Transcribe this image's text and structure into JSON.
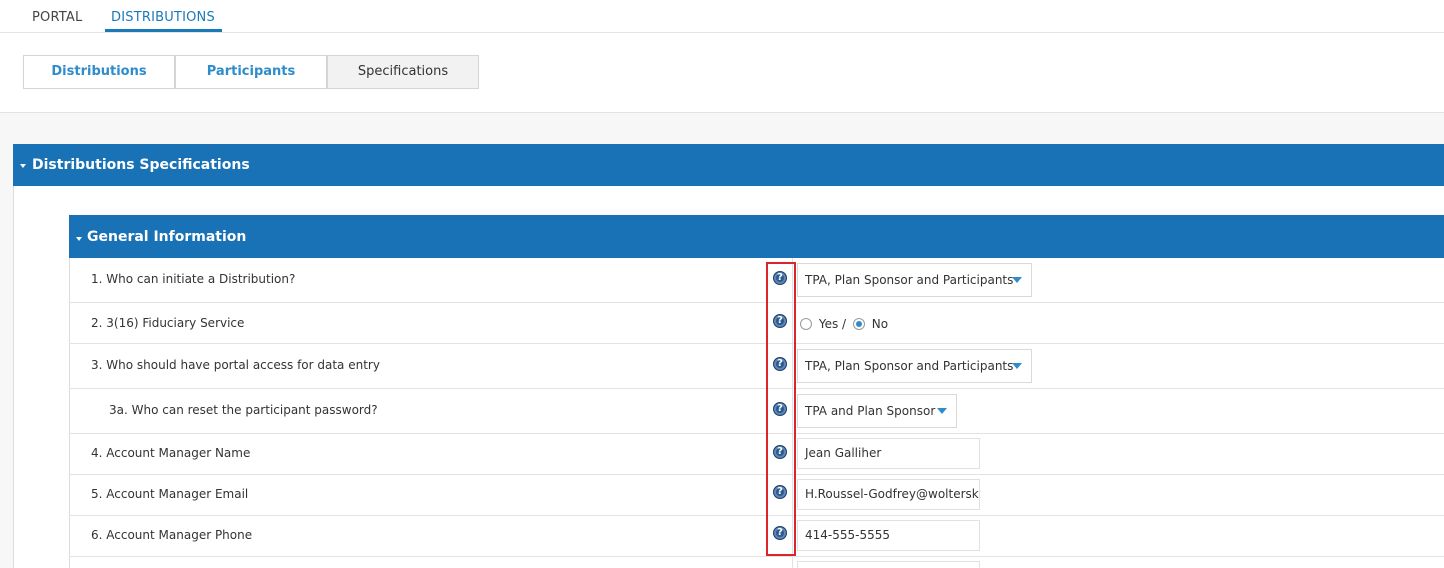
{
  "topnav": {
    "portal": "PORTAL",
    "distributions": "DISTRIBUTIONS"
  },
  "subtabs": {
    "distributions": "Distributions",
    "participants": "Participants",
    "specifications": "Specifications"
  },
  "panel": {
    "title": "Distributions Specifications"
  },
  "section": {
    "title": "General Information"
  },
  "rows": [
    {
      "label": "1. Who can initiate a Distribution?",
      "type": "select",
      "value": "TPA, Plan Sponsor and Participants"
    },
    {
      "label": "2. 3(16) Fiduciary Service",
      "type": "radio",
      "yes": "Yes /",
      "no": "No",
      "selected": "No"
    },
    {
      "label": "3. Who should have portal access for data entry",
      "type": "select",
      "value": "TPA, Plan Sponsor and Participants"
    },
    {
      "label": "3a. Who can reset the participant password?",
      "type": "select",
      "value": "TPA and Plan Sponsor"
    },
    {
      "label": "4. Account Manager Name",
      "type": "text",
      "value": "Jean Galliher"
    },
    {
      "label": "5. Account Manager Email",
      "type": "text",
      "value": "H.Roussel-Godfrey@woltersk"
    },
    {
      "label": "6. Account Manager Phone",
      "type": "text",
      "value": "414-555-5555"
    }
  ],
  "help_icon": "question-circle-icon",
  "colors": {
    "header_blue": "#1a72b6",
    "link_blue": "#2f8ccc",
    "highlight_red": "#d9262c"
  }
}
